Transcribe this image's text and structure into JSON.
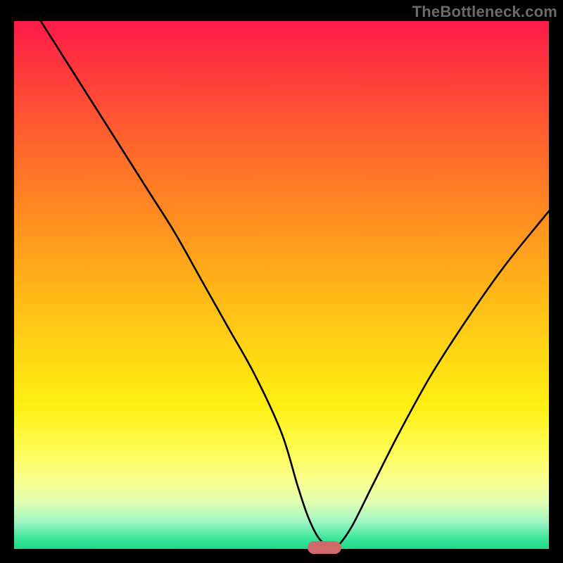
{
  "watermark": "TheBottleneck.com",
  "chart_data": {
    "type": "line",
    "title": "",
    "xlabel": "",
    "ylabel": "",
    "xlim": [
      0,
      100
    ],
    "ylim": [
      0,
      100
    ],
    "grid": false,
    "series": [
      {
        "name": "bottleneck-curve",
        "x": [
          5,
          10,
          15,
          20,
          25,
          30,
          35,
          40,
          45,
          50,
          53,
          55,
          57,
          59,
          60,
          63,
          67,
          72,
          78,
          85,
          92,
          100
        ],
        "values": [
          100,
          92,
          84,
          76,
          68,
          60,
          51,
          42,
          33,
          22,
          12,
          6,
          2,
          0.5,
          0,
          4,
          12,
          22,
          33,
          44,
          54,
          64
        ]
      }
    ],
    "annotations": [
      {
        "name": "minimum-marker",
        "x": 58,
        "y": 0,
        "shape": "pill",
        "color": "#d06a6a"
      }
    ],
    "background": {
      "type": "vertical-gradient",
      "stops": [
        {
          "pos": 0,
          "color": "#ff1a49"
        },
        {
          "pos": 50,
          "color": "#ffb318"
        },
        {
          "pos": 80,
          "color": "#fffb4a"
        },
        {
          "pos": 100,
          "color": "#1fd789"
        }
      ]
    }
  }
}
